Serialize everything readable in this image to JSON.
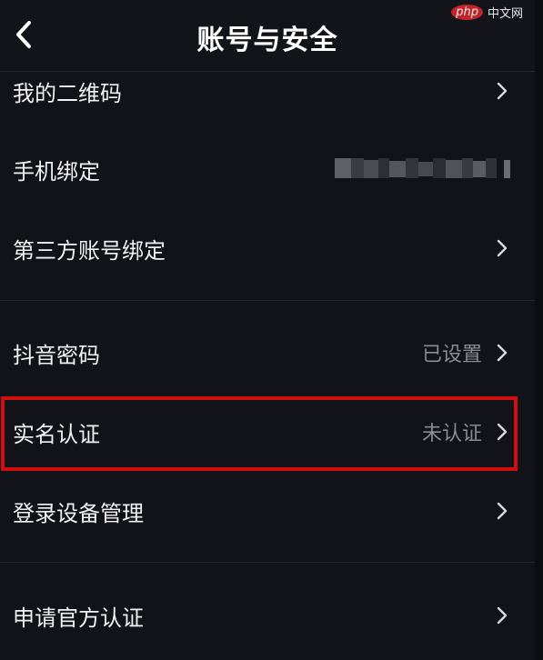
{
  "header": {
    "title": "账号与安全",
    "back_icon": "chevron-left-icon"
  },
  "watermark": {
    "logo_text": "php",
    "site_text": "中文网"
  },
  "settings_items": [
    {
      "label": "我的二维码",
      "value": "",
      "icon": "chevron-right-icon"
    },
    {
      "label": "手机绑定",
      "value": "",
      "icon": "chevron-right-icon"
    },
    {
      "label": "第三方账号绑定",
      "value": "",
      "icon": "chevron-right-icon"
    },
    {
      "label": "抖音密码",
      "value": "已设置",
      "icon": "chevron-right-icon"
    },
    {
      "label": "实名认证",
      "value": "未认证",
      "icon": "chevron-right-icon"
    },
    {
      "label": "登录设备管理",
      "value": "",
      "icon": "chevron-right-icon"
    },
    {
      "label": "申请官方认证",
      "value": "",
      "icon": "chevron-right-icon"
    }
  ],
  "colors": {
    "background": "#121318",
    "text": "#f2f2f4",
    "secondary_text": "#8a8b93",
    "divider": "#23252d",
    "highlight": "#d20f0f"
  }
}
